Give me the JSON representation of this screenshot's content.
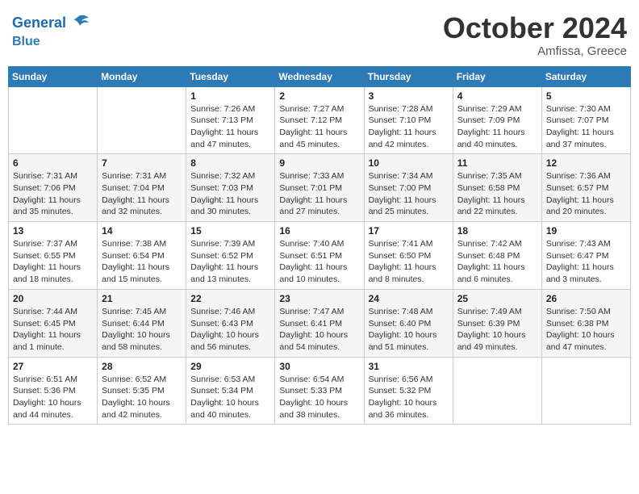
{
  "header": {
    "logo_line1": "General",
    "logo_line2": "Blue",
    "month": "October 2024",
    "location": "Amfissa, Greece"
  },
  "weekdays": [
    "Sunday",
    "Monday",
    "Tuesday",
    "Wednesday",
    "Thursday",
    "Friday",
    "Saturday"
  ],
  "weeks": [
    [
      {
        "day": "",
        "info": ""
      },
      {
        "day": "",
        "info": ""
      },
      {
        "day": "1",
        "info": "Sunrise: 7:26 AM\nSunset: 7:13 PM\nDaylight: 11 hours and 47 minutes."
      },
      {
        "day": "2",
        "info": "Sunrise: 7:27 AM\nSunset: 7:12 PM\nDaylight: 11 hours and 45 minutes."
      },
      {
        "day": "3",
        "info": "Sunrise: 7:28 AM\nSunset: 7:10 PM\nDaylight: 11 hours and 42 minutes."
      },
      {
        "day": "4",
        "info": "Sunrise: 7:29 AM\nSunset: 7:09 PM\nDaylight: 11 hours and 40 minutes."
      },
      {
        "day": "5",
        "info": "Sunrise: 7:30 AM\nSunset: 7:07 PM\nDaylight: 11 hours and 37 minutes."
      }
    ],
    [
      {
        "day": "6",
        "info": "Sunrise: 7:31 AM\nSunset: 7:06 PM\nDaylight: 11 hours and 35 minutes."
      },
      {
        "day": "7",
        "info": "Sunrise: 7:31 AM\nSunset: 7:04 PM\nDaylight: 11 hours and 32 minutes."
      },
      {
        "day": "8",
        "info": "Sunrise: 7:32 AM\nSunset: 7:03 PM\nDaylight: 11 hours and 30 minutes."
      },
      {
        "day": "9",
        "info": "Sunrise: 7:33 AM\nSunset: 7:01 PM\nDaylight: 11 hours and 27 minutes."
      },
      {
        "day": "10",
        "info": "Sunrise: 7:34 AM\nSunset: 7:00 PM\nDaylight: 11 hours and 25 minutes."
      },
      {
        "day": "11",
        "info": "Sunrise: 7:35 AM\nSunset: 6:58 PM\nDaylight: 11 hours and 22 minutes."
      },
      {
        "day": "12",
        "info": "Sunrise: 7:36 AM\nSunset: 6:57 PM\nDaylight: 11 hours and 20 minutes."
      }
    ],
    [
      {
        "day": "13",
        "info": "Sunrise: 7:37 AM\nSunset: 6:55 PM\nDaylight: 11 hours and 18 minutes."
      },
      {
        "day": "14",
        "info": "Sunrise: 7:38 AM\nSunset: 6:54 PM\nDaylight: 11 hours and 15 minutes."
      },
      {
        "day": "15",
        "info": "Sunrise: 7:39 AM\nSunset: 6:52 PM\nDaylight: 11 hours and 13 minutes."
      },
      {
        "day": "16",
        "info": "Sunrise: 7:40 AM\nSunset: 6:51 PM\nDaylight: 11 hours and 10 minutes."
      },
      {
        "day": "17",
        "info": "Sunrise: 7:41 AM\nSunset: 6:50 PM\nDaylight: 11 hours and 8 minutes."
      },
      {
        "day": "18",
        "info": "Sunrise: 7:42 AM\nSunset: 6:48 PM\nDaylight: 11 hours and 6 minutes."
      },
      {
        "day": "19",
        "info": "Sunrise: 7:43 AM\nSunset: 6:47 PM\nDaylight: 11 hours and 3 minutes."
      }
    ],
    [
      {
        "day": "20",
        "info": "Sunrise: 7:44 AM\nSunset: 6:45 PM\nDaylight: 11 hours and 1 minute."
      },
      {
        "day": "21",
        "info": "Sunrise: 7:45 AM\nSunset: 6:44 PM\nDaylight: 10 hours and 58 minutes."
      },
      {
        "day": "22",
        "info": "Sunrise: 7:46 AM\nSunset: 6:43 PM\nDaylight: 10 hours and 56 minutes."
      },
      {
        "day": "23",
        "info": "Sunrise: 7:47 AM\nSunset: 6:41 PM\nDaylight: 10 hours and 54 minutes."
      },
      {
        "day": "24",
        "info": "Sunrise: 7:48 AM\nSunset: 6:40 PM\nDaylight: 10 hours and 51 minutes."
      },
      {
        "day": "25",
        "info": "Sunrise: 7:49 AM\nSunset: 6:39 PM\nDaylight: 10 hours and 49 minutes."
      },
      {
        "day": "26",
        "info": "Sunrise: 7:50 AM\nSunset: 6:38 PM\nDaylight: 10 hours and 47 minutes."
      }
    ],
    [
      {
        "day": "27",
        "info": "Sunrise: 6:51 AM\nSunset: 5:36 PM\nDaylight: 10 hours and 44 minutes."
      },
      {
        "day": "28",
        "info": "Sunrise: 6:52 AM\nSunset: 5:35 PM\nDaylight: 10 hours and 42 minutes."
      },
      {
        "day": "29",
        "info": "Sunrise: 6:53 AM\nSunset: 5:34 PM\nDaylight: 10 hours and 40 minutes."
      },
      {
        "day": "30",
        "info": "Sunrise: 6:54 AM\nSunset: 5:33 PM\nDaylight: 10 hours and 38 minutes."
      },
      {
        "day": "31",
        "info": "Sunrise: 6:56 AM\nSunset: 5:32 PM\nDaylight: 10 hours and 36 minutes."
      },
      {
        "day": "",
        "info": ""
      },
      {
        "day": "",
        "info": ""
      }
    ]
  ]
}
